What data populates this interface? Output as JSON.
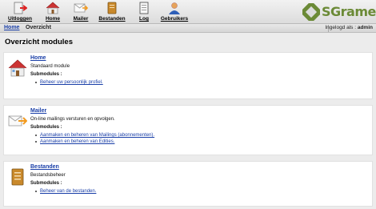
{
  "toolbar": {
    "items": [
      {
        "label": "Uitloggen",
        "icon": "logout-icon"
      },
      {
        "label": "Home",
        "icon": "home-icon"
      },
      {
        "label": "Mailer",
        "icon": "mailer-icon"
      },
      {
        "label": "Bestanden",
        "icon": "files-icon"
      },
      {
        "label": "Log",
        "icon": "log-icon"
      },
      {
        "label": "Gebruikers",
        "icon": "users-icon"
      }
    ]
  },
  "logo": {
    "text": "SGrame"
  },
  "breadcrumb": {
    "home": "Home",
    "current": "Overzicht"
  },
  "login": {
    "label": "Ingelogd als :",
    "user": "admin"
  },
  "page": {
    "title": "Overzicht modules"
  },
  "modules": [
    {
      "title": "Home",
      "description": "Standaard module",
      "submodules_label": "Submodules :",
      "submodules": [
        "Beheer uw persoonlijk profiel."
      ]
    },
    {
      "title": "Mailer",
      "description": "On-line mailings versturen en opvolgen.",
      "submodules_label": "Submodules :",
      "submodules": [
        "Aanmaken en beheren van Mailings (abonnementen).",
        "Aanmaken en beheren van Edities."
      ]
    },
    {
      "title": "Bestanden",
      "description": "Bestandsbeheer",
      "submodules_label": "Submodules :",
      "submodules": [
        "Beheer van de bestanden."
      ]
    }
  ],
  "colors": {
    "link": "#1a3fa8",
    "brand": "#6b8a36"
  }
}
